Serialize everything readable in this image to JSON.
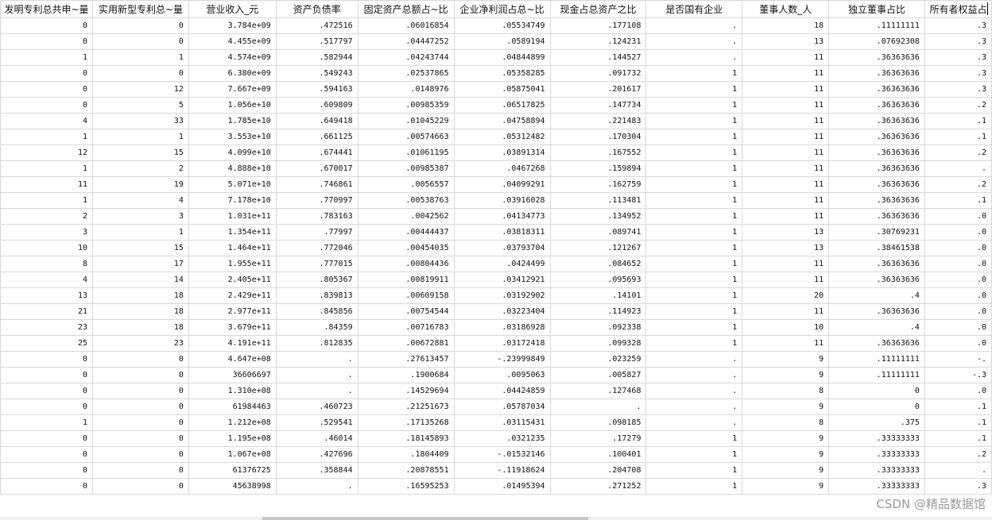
{
  "columns": [
    "发明专利总共申~量",
    "实用新型专利总~量",
    "营业收入_元",
    "资产负债率",
    "固定资产总额占~比",
    "企业净利润占总~比",
    "现金占总资产之比",
    "是否国有企业",
    "董事人数_人",
    "独立董事占比",
    "所有者权益占"
  ],
  "rows": [
    [
      "0",
      "0",
      "3.784e+09",
      ".472516",
      ".06016854",
      ".05534749",
      ".177108",
      ".",
      "18",
      ".11111111",
      ".3"
    ],
    [
      "0",
      "0",
      "4.455e+09",
      ".517797",
      ".04447252",
      ".0589194",
      ".124231",
      ".",
      "13",
      ".07692308",
      ".3"
    ],
    [
      "1",
      "1",
      "4.574e+09",
      ".582944",
      ".04243744",
      ".04844899",
      ".144527",
      ".",
      "11",
      ".36363636",
      ".3"
    ],
    [
      "0",
      "0",
      "6.380e+09",
      ".549243",
      ".02537865",
      ".05358285",
      ".091732",
      "1",
      "11",
      ".36363636",
      ".3"
    ],
    [
      "0",
      "12",
      "7.667e+09",
      ".594163",
      ".0148976",
      ".05875041",
      ".201617",
      "1",
      "11",
      ".36363636",
      ".3"
    ],
    [
      "0",
      "5",
      "1.056e+10",
      ".609809",
      ".00985359",
      ".06517825",
      ".147734",
      "1",
      "11",
      ".36363636",
      ".2"
    ],
    [
      "4",
      "33",
      "1.785e+10",
      ".649418",
      ".01045229",
      ".04758894",
      ".221483",
      "1",
      "11",
      ".36363636",
      ".1"
    ],
    [
      "1",
      "1",
      "3.553e+10",
      ".661125",
      ".00574663",
      ".05312482",
      ".170304",
      "1",
      "11",
      ".36363636",
      ".1"
    ],
    [
      "12",
      "15",
      "4.099e+10",
      ".674441",
      ".01061195",
      ".03891314",
      ".167552",
      "1",
      "11",
      ".36363636",
      ".2"
    ],
    [
      "1",
      "2",
      "4.888e+10",
      ".670017",
      ".00985387",
      ".0467268",
      ".159894",
      "1",
      "11",
      ".36363636",
      "."
    ],
    [
      "11",
      "19",
      "5.071e+10",
      ".746861",
      ".0056557",
      ".04099291",
      ".162759",
      "1",
      "11",
      ".36363636",
      ".2"
    ],
    [
      "1",
      "4",
      "7.178e+10",
      ".770997",
      ".00538763",
      ".03916028",
      ".113481",
      "1",
      "11",
      ".36363636",
      ".1"
    ],
    [
      "2",
      "3",
      "1.031e+11",
      ".783163",
      ".0042562",
      ".04134773",
      ".134952",
      "1",
      "11",
      ".36363636",
      ".0"
    ],
    [
      "3",
      "1",
      "1.354e+11",
      ".77997",
      ".00444437",
      ".03818311",
      ".089741",
      "1",
      "13",
      ".30769231",
      ".0"
    ],
    [
      "10",
      "15",
      "1.464e+11",
      ".772046",
      ".00454035",
      ".03793704",
      ".121267",
      "1",
      "13",
      ".38461538",
      ".0"
    ],
    [
      "8",
      "17",
      "1.955e+11",
      ".777015",
      ".00804436",
      ".0424499",
      ".084652",
      "1",
      "11",
      ".36363636",
      ".0"
    ],
    [
      "4",
      "14",
      "2.405e+11",
      ".805367",
      ".00819911",
      ".03412921",
      ".095693",
      "1",
      "11",
      ".36363636",
      ".0"
    ],
    [
      "13",
      "18",
      "2.429e+11",
      ".839813",
      ".00609158",
      ".03192902",
      ".14101",
      "1",
      "20",
      ".4",
      ".0"
    ],
    [
      "21",
      "18",
      "2.977e+11",
      ".845856",
      ".00754544",
      ".03223404",
      ".114923",
      "1",
      "11",
      ".36363636",
      ".0"
    ],
    [
      "23",
      "18",
      "3.679e+11",
      ".84359",
      ".00716783",
      ".03186928",
      ".092338",
      "1",
      "10",
      ".4",
      ".0"
    ],
    [
      "25",
      "23",
      "4.191e+11",
      ".812835",
      ".00672881",
      ".03172418",
      ".099328",
      "1",
      "11",
      ".36363636",
      ".0"
    ],
    [
      "0",
      "0",
      "4.647e+08",
      ".",
      ".27613457",
      "-.23999849",
      ".023259",
      ".",
      "9",
      ".11111111",
      "-."
    ],
    [
      "0",
      "0",
      "36606697",
      ".",
      ".1900684",
      ".0095063",
      ".005827",
      ".",
      "9",
      ".11111111",
      "-.3"
    ],
    [
      "0",
      "0",
      "1.310e+08",
      ".",
      ".14529694",
      ".04424859",
      ".127468",
      ".",
      "8",
      "0",
      ".0"
    ],
    [
      "0",
      "0",
      "61984463",
      ".460723",
      ".21251673",
      ".05787034",
      ".",
      ".",
      "9",
      "0",
      ".1"
    ],
    [
      "1",
      "0",
      "1.212e+08",
      ".529541",
      ".17135268",
      ".03115431",
      ".098185",
      ".",
      "8",
      ".375",
      ".1"
    ],
    [
      "0",
      "0",
      "1.195e+08",
      ".46014",
      ".18145893",
      ".0321235",
      ".17279",
      "1",
      "9",
      ".33333333",
      ".1"
    ],
    [
      "0",
      "0",
      "1.067e+08",
      ".427696",
      ".1804409",
      "-.01532146",
      ".100401",
      "1",
      "9",
      ".33333333",
      ".2"
    ],
    [
      "0",
      "0",
      "61376725",
      ".358844",
      ".20878551",
      "-.11918624",
      ".204708",
      "1",
      "9",
      ".33333333",
      "."
    ],
    [
      "0",
      "0",
      "45638998",
      ".",
      ".16595253",
      ".01495394",
      ".271252",
      "1",
      "9",
      ".33333333",
      ".3"
    ]
  ],
  "watermark": "CSDN @精品数据馆"
}
